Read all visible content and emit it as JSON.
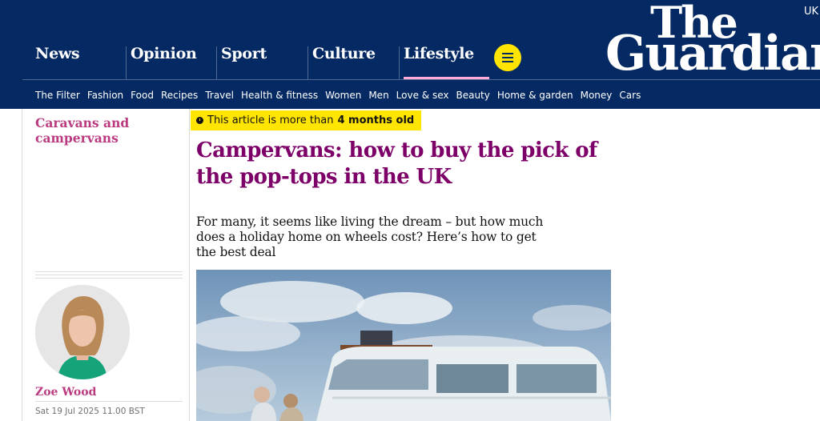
{
  "header": {
    "pillars": [
      {
        "label": "News"
      },
      {
        "label": "Opinion"
      },
      {
        "label": "Sport"
      },
      {
        "label": "Culture"
      },
      {
        "label": "Lifestyle"
      }
    ],
    "menu_icon": "hamburger-menu-icon",
    "logo_line1": "The",
    "logo_line2": "Guardian",
    "edition": "UK",
    "subnav": [
      "The Filter",
      "Fashion",
      "Food",
      "Recipes",
      "Travel",
      "Health & fitness",
      "Women",
      "Men",
      "Love & sex",
      "Beauty",
      "Home & garden",
      "Money",
      "Cars"
    ]
  },
  "article": {
    "section": "Caravans and campervans",
    "age_notice_prefix": "This article is more than",
    "age_notice_value": "4 months old",
    "headline": "Campervans: how to buy the pick of the pop-tops in the UK",
    "standfirst": "For many, it seems like living the dream – but how much does a holiday home on wheels cost? Here’s how to get the best deal",
    "author": "Zoe Wood",
    "published": "Sat 19 Jul 2025 11.00 BST"
  },
  "colors": {
    "brand_navy": "#052962",
    "lifestyle_headline": "#7d0068",
    "lifestyle_accent": "#bb3b80",
    "highlight_yellow": "#ffe500",
    "pillar_underline": "#ffabdb"
  }
}
